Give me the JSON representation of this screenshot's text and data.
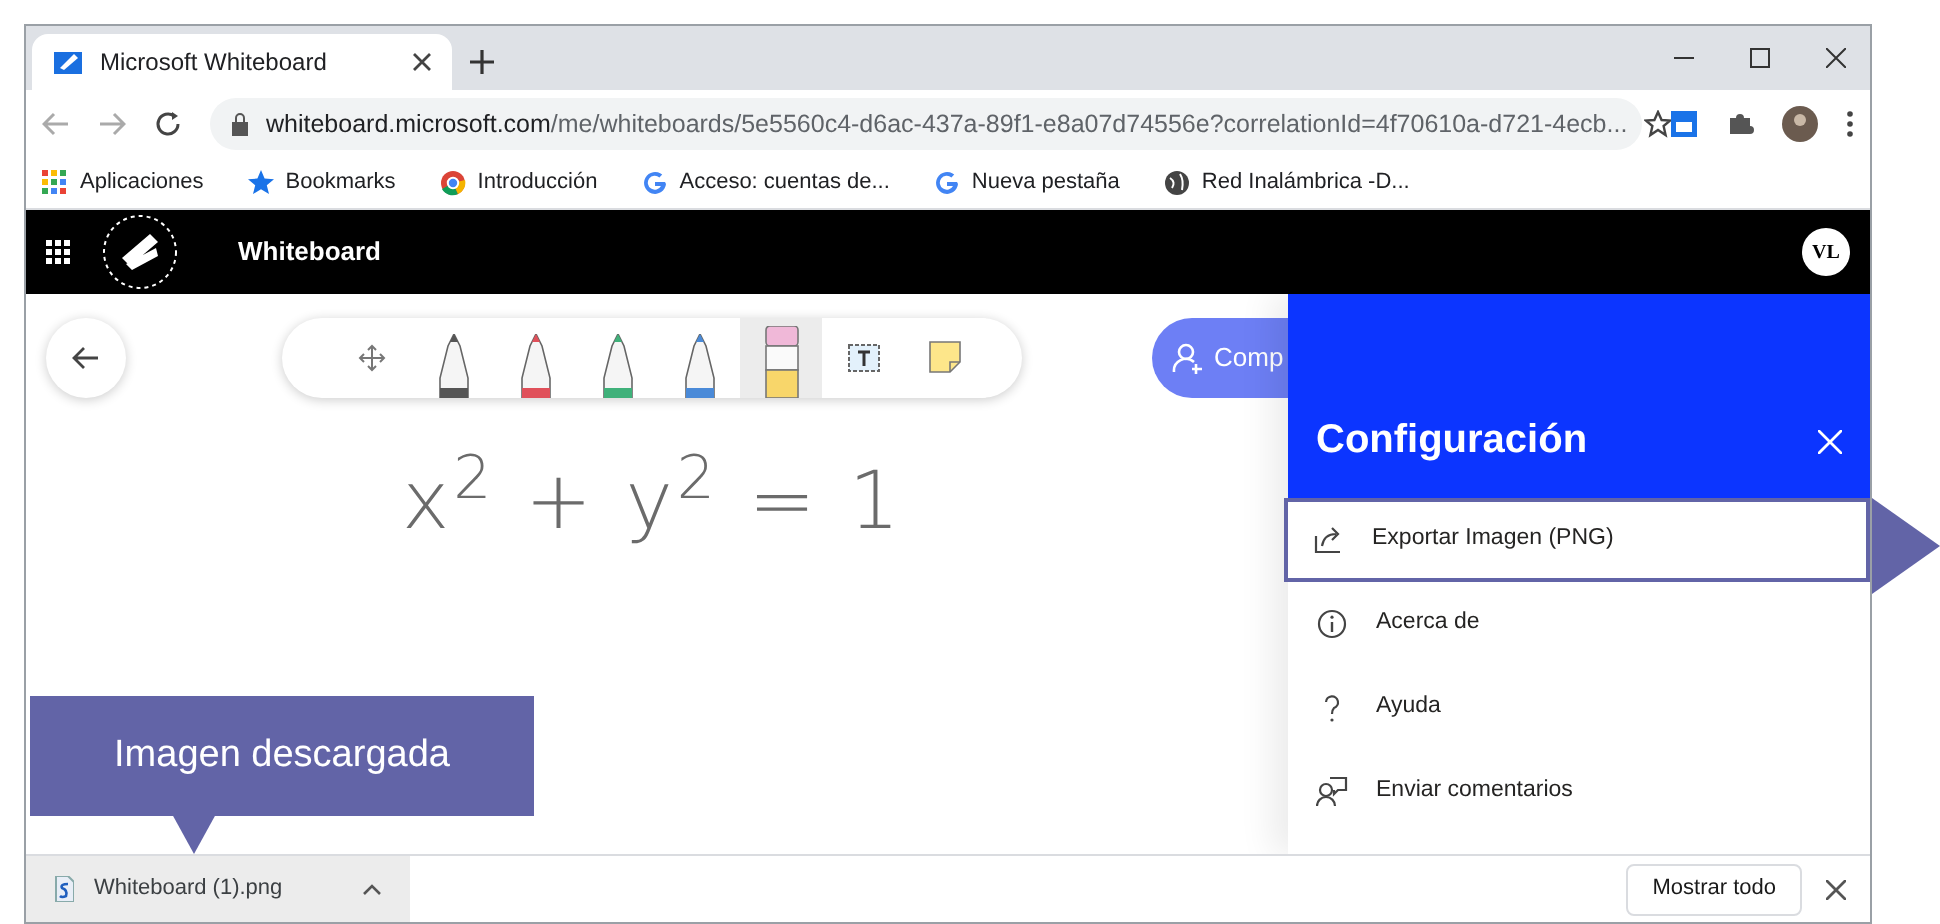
{
  "browser": {
    "tab_title": "Microsoft Whiteboard",
    "url_host": "whiteboard.microsoft.com",
    "url_path": "/me/whiteboards/5e5560c4-d6ac-437a-89f1-e8a07d74556e?correlationId=4f70610a-d721-4ecb...",
    "bookmarks": [
      {
        "label": "Aplicaciones",
        "kind": "apps"
      },
      {
        "label": "Bookmarks",
        "kind": "star"
      },
      {
        "label": "Introducción",
        "kind": "chrome"
      },
      {
        "label": "Acceso: cuentas de...",
        "kind": "google"
      },
      {
        "label": "Nueva pestaña",
        "kind": "google"
      },
      {
        "label": "Red Inalámbrica -D...",
        "kind": "globe"
      }
    ]
  },
  "app": {
    "title": "Whiteboard",
    "avatar": "VL"
  },
  "toolbar": [
    {
      "kind": "move",
      "selected": false
    },
    {
      "kind": "pen",
      "color": "#555555",
      "selected": false
    },
    {
      "kind": "pen",
      "color": "#e0505a",
      "selected": false
    },
    {
      "kind": "pen",
      "color": "#3fb17a",
      "selected": false
    },
    {
      "kind": "pen",
      "color": "#4a8ad8",
      "selected": false
    },
    {
      "kind": "eraser",
      "selected": true
    },
    {
      "kind": "text",
      "selected": false
    },
    {
      "kind": "note",
      "selected": false
    }
  ],
  "share_button": "Comp",
  "ink": "x$^{2}$ + y$^{2}$ = 1",
  "settings": {
    "title": "Configuración",
    "items": [
      {
        "label": "Exportar Imagen (PNG)",
        "selected": true
      },
      {
        "label": "Acerca de",
        "selected": false
      },
      {
        "label": "Ayuda",
        "selected": false
      },
      {
        "label": "Enviar comentarios",
        "selected": false
      }
    ]
  },
  "callout": "Imagen descargada",
  "download_bar": {
    "file": "Whiteboard (1).png",
    "show_all": "Mostrar todo"
  }
}
